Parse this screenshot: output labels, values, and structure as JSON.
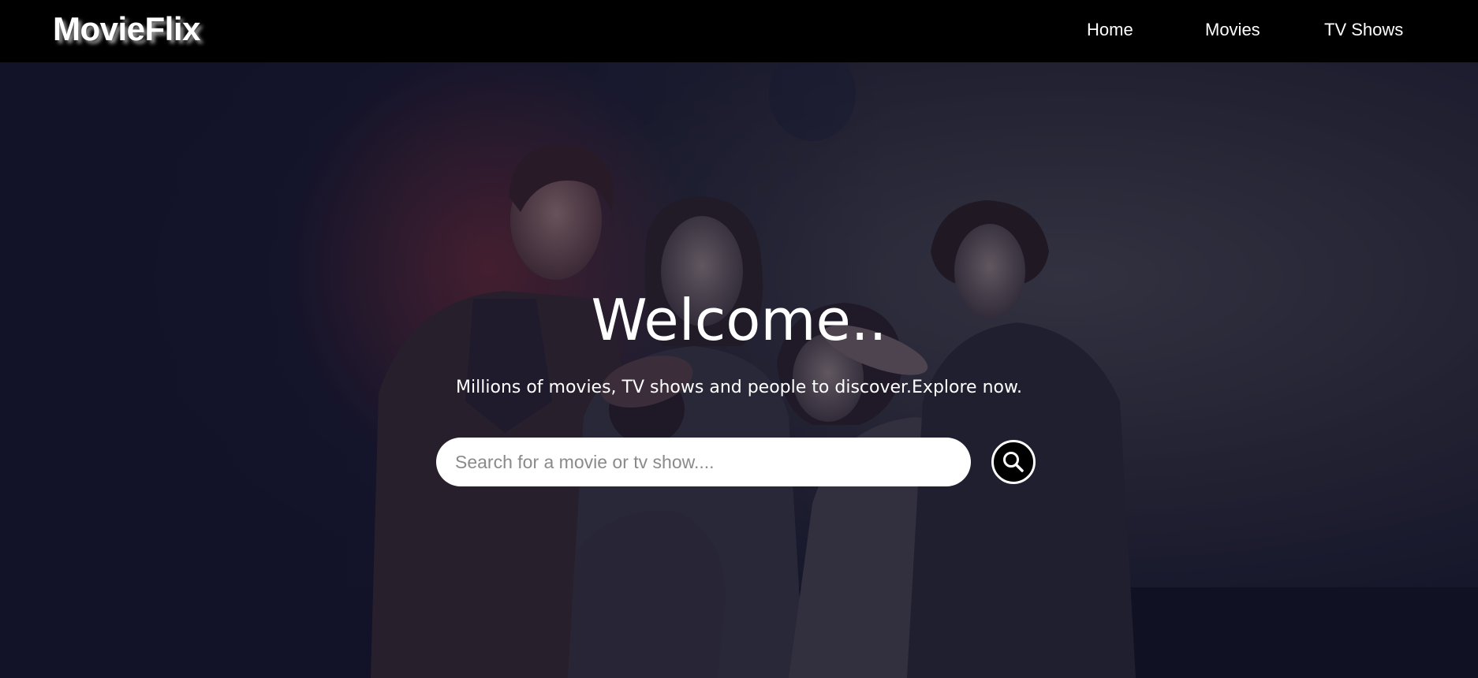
{
  "brand": {
    "name": "MovieFlix"
  },
  "nav": {
    "items": [
      {
        "label": "Home"
      },
      {
        "label": "Movies"
      },
      {
        "label": "TV Shows"
      }
    ]
  },
  "hero": {
    "title": "Welcome..",
    "subtitle": "Millions of movies, TV shows and people to discover.Explore now.",
    "search": {
      "placeholder": "Search for a movie or tv show....",
      "value": "",
      "button_icon": "search-icon"
    },
    "background_image": "family-movie-poster"
  },
  "colors": {
    "navbar_bg": "#000000",
    "text": "#ffffff",
    "hero_tint": "#1a1a33",
    "search_field_bg": "#ffffff",
    "search_button_bg": "#000000"
  }
}
